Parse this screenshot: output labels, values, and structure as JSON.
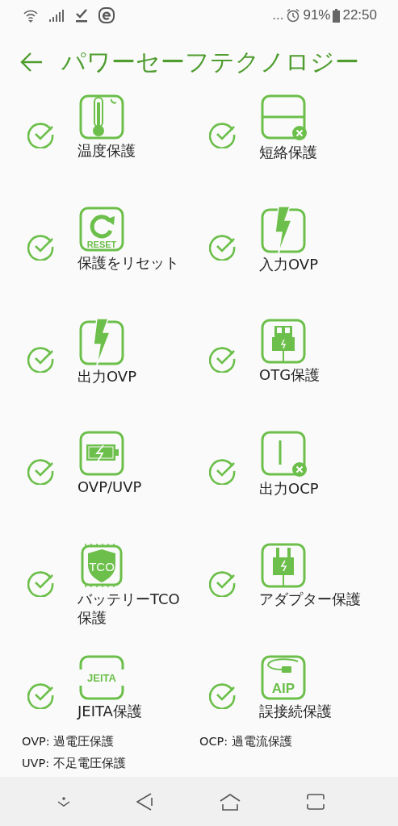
{
  "status_bar": {
    "more": "...",
    "battery": "91%",
    "time": "22:50"
  },
  "app_bar": {
    "title": "パワーセーフテクノロジー"
  },
  "features": [
    {
      "kind": "thermometer",
      "label": "温度保護",
      "checked": true
    },
    {
      "kind": "short-circuit",
      "label": "短絡保護",
      "checked": true
    },
    {
      "kind": "reset",
      "icon_text": "RESET",
      "label": "保護をリセット",
      "checked": true
    },
    {
      "kind": "bolt",
      "label": "入力OVP",
      "checked": true
    },
    {
      "kind": "bolt",
      "label": "出力OVP",
      "checked": true
    },
    {
      "kind": "usb",
      "label": "OTG保護",
      "checked": true
    },
    {
      "kind": "battery",
      "label": "OVP/UVP",
      "checked": true
    },
    {
      "kind": "current",
      "label": "出力OCP",
      "checked": true
    },
    {
      "kind": "chip",
      "icon_text": "TCO",
      "label": "バッテリーTCO保護",
      "checked": true
    },
    {
      "kind": "adapter",
      "label": "アダプター保護",
      "checked": true
    },
    {
      "kind": "badge",
      "icon_text": "JEITA",
      "label": "JEITA保護",
      "checked": true
    },
    {
      "kind": "cable",
      "icon_text": "AIP",
      "label": "誤接続保護",
      "checked": true
    }
  ],
  "footnotes": [
    "OVP: 過電圧保護",
    "OCP: 過電流保護",
    "UVP: 不足電圧保護"
  ]
}
